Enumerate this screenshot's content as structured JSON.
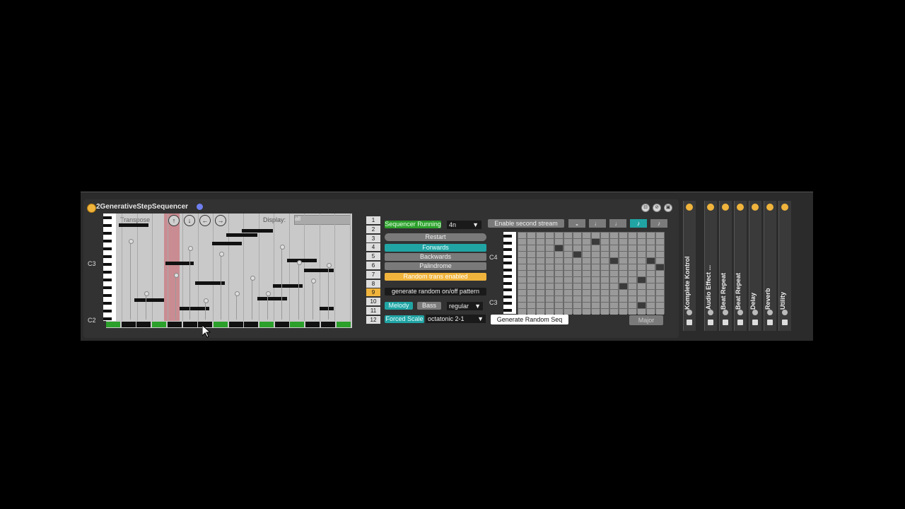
{
  "device": {
    "title": "2GenerativeStepSequencer",
    "transpose_label": "Transpose",
    "display_label": "Display:",
    "display_value": "all",
    "octave_top": "C3",
    "octave_bottom": "C2",
    "arrows": [
      "↑",
      "↓",
      "←",
      "→"
    ]
  },
  "steps": [
    "1",
    "2",
    "3",
    "4",
    "5",
    "6",
    "7",
    "8",
    "9",
    "10",
    "11",
    "12"
  ],
  "selected_step": "9",
  "controls": {
    "running": "Sequencer Running",
    "rate": "4n",
    "restart": "Restart",
    "forwards": "Forwards",
    "backwards": "Backwards",
    "palindrome": "Palindrome",
    "random_trans": "Random trans enabled",
    "generate_onoff": "generate random on/off pattern",
    "melody": "Melody",
    "bass": "Bass",
    "mode": "regular",
    "forced_scale": "Forced Scale",
    "scale": "octatonic 2-1"
  },
  "right_panel": {
    "enable_second": "Enable second stream",
    "c4": "C4",
    "c3": "C3",
    "generate_random": "Generate Random Seq",
    "major": "Major",
    "note_buttons": [
      "𝅝",
      "♩",
      "♩",
      "♪",
      "♪"
    ]
  },
  "chain": [
    "Komplete Kontrol",
    "Audio Effect ...",
    "Beat Repeat",
    "Beat Repeat",
    "Delay",
    "Reverb",
    "Utility"
  ]
}
